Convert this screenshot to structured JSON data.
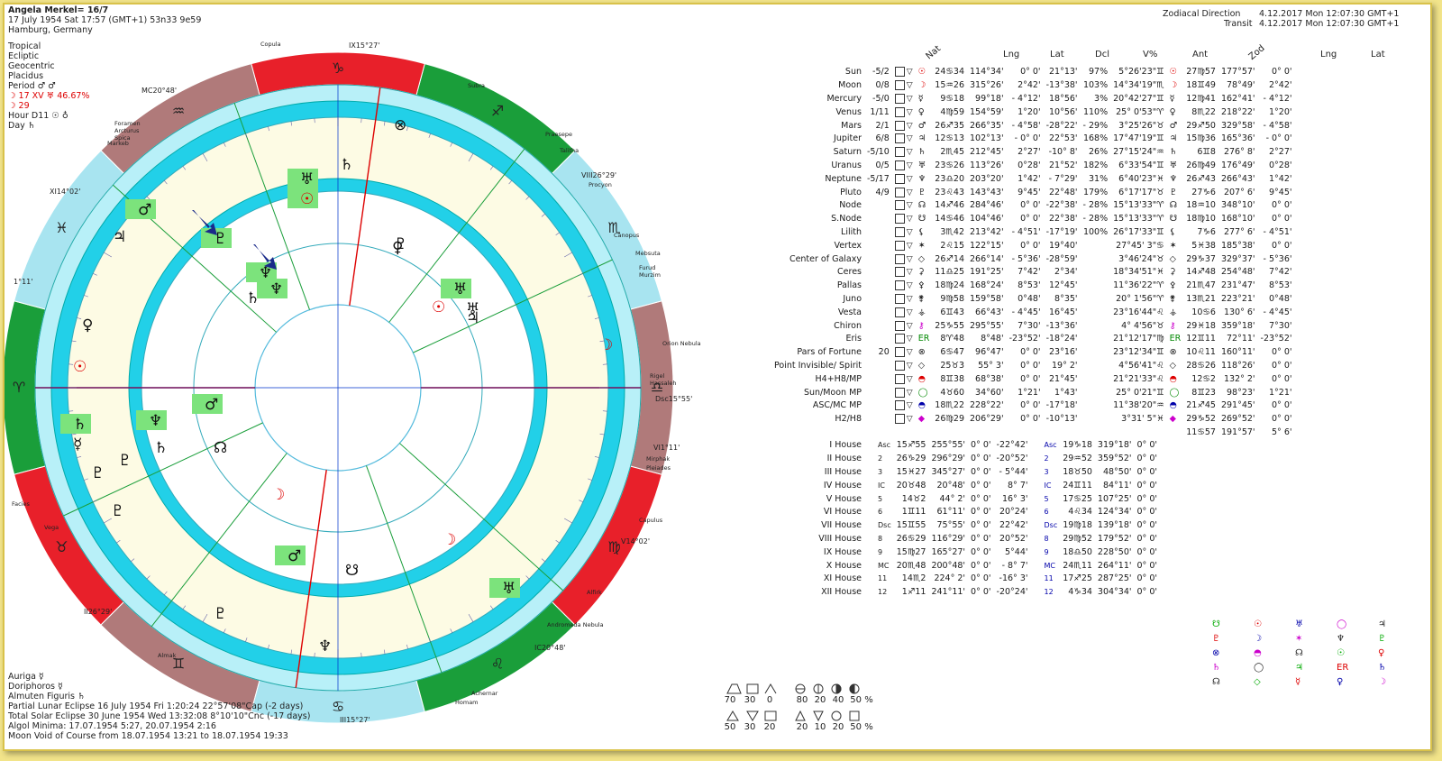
{
  "header": {
    "name": "Angela Merkel= 16/7",
    "date_line": "17 July 1954  Sat  17:57 (GMT+1) 53n33  9e59",
    "place": "Hamburg, Germany"
  },
  "settings": [
    "Tropical",
    "Ecliptic",
    "Geocentric",
    "Placidus",
    "Period ♂ ♂"
  ],
  "moon_line": "☽ 17 XV ♅ 46.67%",
  "moon_line2": "☽ 29",
  "hour_line": "Hour D11 ☉ ♁",
  "day_line": "Day ♄",
  "top_right": {
    "zd_label": "Zodiacal Direction",
    "zd_value": "4.12.2017  Mon 12:07:30 GMT+1",
    "tr_label": "Transit",
    "tr_value": "4.12.2017  Mon 12:07:30 GMT+1"
  },
  "columns": {
    "nat": "Nat",
    "lng": "Lng",
    "lat": "Lat",
    "dcl": "Dcl",
    "vpct": "V%",
    "ant": "Ant",
    "zod": "Zod",
    "lng2": "Lng",
    "lat2": "Lat"
  },
  "planets": [
    {
      "name": "Sun",
      "score": "-5/2",
      "sym": "☉",
      "c": "red",
      "lng": "24♋34",
      "lng2": "114°34'",
      "lat": "0° 0'",
      "dcl": "21°13'",
      "v": "97%",
      "ant": "5°26'23\"♊",
      "z": "27♍57",
      "zl": "177°57'",
      "zlat": "0° 0'"
    },
    {
      "name": "Moon",
      "score": "0/8",
      "sym": "☽",
      "c": "red",
      "lng": "15♒26",
      "lng2": "315°26'",
      "lat": "2°42'",
      "dcl": "-13°38'",
      "v": "103%",
      "ant": "14°34'19\"♏",
      "z": "18♊49",
      "zl": "78°49'",
      "zlat": "2°42'"
    },
    {
      "name": "Mercury",
      "score": "-5/0",
      "sym": "☿",
      "c": "",
      "lng": "9♋18",
      "lng2": "99°18'",
      "lat": "- 4°12'",
      "dcl": "18°56'",
      "v": "3%",
      "ant": "20°42'27\"♊",
      "z": "12♍41",
      "zl": "162°41'",
      "zlat": "- 4°12'"
    },
    {
      "name": "Venus",
      "score": "1/11",
      "sym": "♀",
      "c": "",
      "lng": "4♍59",
      "lng2": "154°59'",
      "lat": "1°20'",
      "dcl": "10°56'",
      "v": "110%",
      "ant": "25° 0'53\"♈",
      "z": "8♏22",
      "zl": "218°22'",
      "zlat": "1°20'"
    },
    {
      "name": "Mars",
      "score": "2/1",
      "sym": "♂",
      "c": "",
      "lng": "26♐35",
      "lng2": "266°35'",
      "lat": "- 4°58'",
      "dcl": "-28°22'",
      "v": "- 29%",
      "ant": "3°25'26\"♉",
      "z": "29♐50",
      "zl": "329°58'",
      "zlat": "- 4°58'"
    },
    {
      "name": "Jupiter",
      "score": "6/8",
      "sym": "♃",
      "c": "",
      "lng": "12♋13",
      "lng2": "102°13'",
      "lat": "- 0° 0'",
      "dcl": "22°53'",
      "v": "168%",
      "ant": "17°47'19\"♊",
      "z": "15♍36",
      "zl": "165°36'",
      "zlat": "- 0° 0'"
    },
    {
      "name": "Saturn",
      "score": "-5/10",
      "sym": "♄",
      "c": "",
      "lng": "2♏45",
      "lng2": "212°45'",
      "lat": "2°27'",
      "dcl": "-10° 8'",
      "v": "26%",
      "ant": "27°15'24\"♒",
      "z": "6♊8",
      "zl": "276° 8'",
      "zlat": "2°27'"
    },
    {
      "name": "Uranus",
      "score": "0/5",
      "sym": "♅",
      "c": "",
      "lng": "23♋26",
      "lng2": "113°26'",
      "lat": "0°28'",
      "dcl": "21°52'",
      "v": "182%",
      "ant": "6°33'54\"♊",
      "z": "26♍49",
      "zl": "176°49'",
      "zlat": "0°28'"
    },
    {
      "name": "Neptune",
      "score": "-5/17",
      "sym": "♆",
      "c": "",
      "lng": "23♎20",
      "lng2": "203°20'",
      "lat": "1°42'",
      "dcl": "- 7°29'",
      "v": "31%",
      "ant": "6°40'23\"♓",
      "z": "26♐43",
      "zl": "266°43'",
      "zlat": "1°42'"
    },
    {
      "name": "Pluto",
      "score": "4/9",
      "sym": "♇",
      "c": "",
      "lng": "23♌43",
      "lng2": "143°43'",
      "lat": "9°45'",
      "dcl": "22°48'",
      "v": "179%",
      "ant": "6°17'17\"♉",
      "z": "27♑6",
      "zl": "207° 6'",
      "zlat": "9°45'"
    },
    {
      "name": "Node",
      "score": "",
      "sym": "☊",
      "c": "",
      "lng": "14♐46",
      "lng2": "284°46'",
      "lat": "0° 0'",
      "dcl": "-22°38'",
      "v": "- 28%",
      "ant": "15°13'33\"♈",
      "z": "18♒10",
      "zl": "348°10'",
      "zlat": "0° 0'"
    },
    {
      "name": "S.Node",
      "score": "",
      "sym": "☋",
      "c": "",
      "lng": "14♋46",
      "lng2": "104°46'",
      "lat": "0° 0'",
      "dcl": "22°38'",
      "v": "- 28%",
      "ant": "15°13'33\"♈",
      "z": "18♍10",
      "zl": "168°10'",
      "zlat": "0° 0'"
    },
    {
      "name": "Lilith",
      "score": "",
      "sym": "⚸",
      "c": "",
      "lng": "3♏42",
      "lng2": "213°42'",
      "lat": "- 4°51'",
      "dcl": "-17°19'",
      "v": "100%",
      "ant": "26°17'33\"♊",
      "z": "7♑6",
      "zl": "277° 6'",
      "zlat": "- 4°51'"
    },
    {
      "name": "Vertex",
      "score": "",
      "sym": "✶",
      "c": "",
      "lng": "2♌15",
      "lng2": "122°15'",
      "lat": "0° 0'",
      "dcl": "19°40'",
      "v": "",
      "ant": "27°45' 3\"♋",
      "z": "5♓38",
      "zl": "185°38'",
      "zlat": "0° 0'"
    },
    {
      "name": "Center of Galaxy",
      "score": "",
      "sym": "◇",
      "c": "",
      "lng": "26♐14",
      "lng2": "266°14'",
      "lat": "- 5°36'",
      "dcl": "-28°59'",
      "v": "",
      "ant": "3°46'24\"♉",
      "z": "29♑37",
      "zl": "329°37'",
      "zlat": "- 5°36'"
    },
    {
      "name": "Ceres",
      "score": "",
      "sym": "⚳",
      "c": "",
      "lng": "11♎25",
      "lng2": "191°25'",
      "lat": "7°42'",
      "dcl": "2°34'",
      "v": "",
      "ant": "18°34'51\"♓",
      "z": "14♐48",
      "zl": "254°48'",
      "zlat": "7°42'"
    },
    {
      "name": "Pallas",
      "score": "",
      "sym": "⚴",
      "c": "",
      "lng": "18♍24",
      "lng2": "168°24'",
      "lat": "8°53'",
      "dcl": "12°45'",
      "v": "",
      "ant": "11°36'22\"♈",
      "z": "21♏47",
      "zl": "231°47'",
      "zlat": "8°53'"
    },
    {
      "name": "Juno",
      "score": "",
      "sym": "⚵",
      "c": "",
      "lng": "9♍58",
      "lng2": "159°58'",
      "lat": "0°48'",
      "dcl": "8°35'",
      "v": "",
      "ant": "20° 1'56\"♈",
      "z": "13♏21",
      "zl": "223°21'",
      "zlat": "0°48'"
    },
    {
      "name": "Vesta",
      "score": "",
      "sym": "⚶",
      "c": "",
      "lng": "6♊43",
      "lng2": "66°43'",
      "lat": "- 4°45'",
      "dcl": "16°45'",
      "v": "",
      "ant": "23°16'44\"♌",
      "z": "10♋6",
      "zl": "130° 6'",
      "zlat": "- 4°45'"
    },
    {
      "name": "Chiron",
      "score": "",
      "sym": "⚷",
      "c": "mag",
      "lng": "25♑55",
      "lng2": "295°55'",
      "lat": "7°30'",
      "dcl": "-13°36'",
      "v": "",
      "ant": "4° 4'56\"♉",
      "z": "29♓18",
      "zl": "359°18'",
      "zlat": "7°30'"
    },
    {
      "name": "Eris",
      "score": "",
      "sym": "ER",
      "c": "gr",
      "lng": "8♈48",
      "lng2": "8°48'",
      "lat": "-23°52'",
      "dcl": "-18°24'",
      "v": "",
      "ant": "21°12'17\"♍",
      "z": "12♊11",
      "zl": "72°11'",
      "zlat": "-23°52'"
    },
    {
      "name": "Pars of Fortune",
      "score": "20",
      "sym": "⊗",
      "c": "",
      "lng": "6♋47",
      "lng2": "96°47'",
      "lat": "0° 0'",
      "dcl": "23°16'",
      "v": "",
      "ant": "23°12'34\"♊",
      "z": "10♌11",
      "zl": "160°11'",
      "zlat": "0° 0'"
    },
    {
      "name": "Point Invisible/ Spirit",
      "score": "",
      "sym": "◇",
      "c": "",
      "lng": "25♉3",
      "lng2": "55° 3'",
      "lat": "0° 0'",
      "dcl": "19° 2'",
      "v": "",
      "ant": "4°56'41\"♌",
      "z": "28♋26",
      "zl": "118°26'",
      "zlat": "0° 0'"
    },
    {
      "name": "H4+H8/MP",
      "score": "",
      "sym": "◓",
      "c": "red",
      "lng": "8♊38",
      "lng2": "68°38'",
      "lat": "0° 0'",
      "dcl": "21°45'",
      "v": "",
      "ant": "21°21'33\"♌",
      "z": "12♋2",
      "zl": "132° 2'",
      "zlat": "0° 0'"
    },
    {
      "name": "Sun/Moon MP",
      "score": "",
      "sym": "◯",
      "c": "gr",
      "lng": "4♉60",
      "lng2": "34°60'",
      "lat": "1°21'",
      "dcl": "1°43'",
      "v": "",
      "ant": "25° 0'21\"♊",
      "z": "8♊23",
      "zl": "98°23'",
      "zlat": "1°21'"
    },
    {
      "name": "ASC/MC MP",
      "score": "",
      "sym": "◓",
      "c": "bl",
      "lng": "18♏22",
      "lng2": "228°22'",
      "lat": "0° 0'",
      "dcl": "-17°18'",
      "v": "",
      "ant": "11°38'20\"♒",
      "z": "21♐45",
      "zl": "291°45'",
      "zlat": "0° 0'"
    },
    {
      "name": "H2/H8",
      "score": "",
      "sym": "◆",
      "c": "mag",
      "lng": "26♍29",
      "lng2": "206°29'",
      "lat": "0° 0'",
      "dcl": "-10°13'",
      "v": "",
      "ant": "3°31' 5\"♓",
      "z": "29♑52",
      "zl": "269°52'",
      "zlat": "0° 0'"
    },
    {
      "name": "",
      "score": "",
      "sym": "",
      "c": "",
      "lng": "",
      "lng2": "",
      "lat": "",
      "dcl": "",
      "v": "",
      "ant": "",
      "z": "11♋57",
      "zl": "191°57'",
      "zlat": "5° 6'"
    }
  ],
  "houses": [
    {
      "name": "I House",
      "sym": "Asc",
      "lng": "15♐55",
      "lng2": "255°55'",
      "lat": "0° 0'",
      "dcl": "-22°42'",
      "z": "19♑18",
      "zl": "319°18'",
      "zlat": "0° 0'"
    },
    {
      "name": "II House",
      "sym": "2",
      "lng": "26♑29",
      "lng2": "296°29'",
      "lat": "0° 0'",
      "dcl": "-20°52'",
      "z": "29♒52",
      "zl": "359°52'",
      "zlat": "0° 0'"
    },
    {
      "name": "III House",
      "sym": "3",
      "lng": "15♓27",
      "lng2": "345°27'",
      "lat": "0° 0'",
      "dcl": "- 5°44'",
      "z": "18♉50",
      "zl": "48°50'",
      "zlat": "0° 0'"
    },
    {
      "name": "IV House",
      "sym": "IC",
      "lng": "20♉48",
      "lng2": "20°48'",
      "lat": "0° 0'",
      "dcl": "8° 7'",
      "z": "24♊11",
      "zl": "84°11'",
      "zlat": "0° 0'"
    },
    {
      "name": "V House",
      "sym": "5",
      "lng": "14♉2",
      "lng2": "44° 2'",
      "lat": "0° 0'",
      "dcl": "16° 3'",
      "z": "17♋25",
      "zl": "107°25'",
      "zlat": "0° 0'"
    },
    {
      "name": "VI House",
      "sym": "6",
      "lng": "1♊11",
      "lng2": "61°11'",
      "lat": "0° 0'",
      "dcl": "20°24'",
      "z": "4♌34",
      "zl": "124°34'",
      "zlat": "0° 0'"
    },
    {
      "name": "VII House",
      "sym": "Dsc",
      "lng": "15♊55",
      "lng2": "75°55'",
      "lat": "0° 0'",
      "dcl": "22°42'",
      "z": "19♍18",
      "zl": "139°18'",
      "zlat": "0° 0'"
    },
    {
      "name": "VIII House",
      "sym": "8",
      "lng": "26♋29",
      "lng2": "116°29'",
      "lat": "0° 0'",
      "dcl": "20°52'",
      "z": "29♍52",
      "zl": "179°52'",
      "zlat": "0° 0'"
    },
    {
      "name": "IX House",
      "sym": "9",
      "lng": "15♍27",
      "lng2": "165°27'",
      "lat": "0° 0'",
      "dcl": "5°44'",
      "z": "18♎50",
      "zl": "228°50'",
      "zlat": "0° 0'"
    },
    {
      "name": "X House",
      "sym": "MC",
      "lng": "20♏48",
      "lng2": "200°48'",
      "lat": "0° 0'",
      "dcl": "- 8° 7'",
      "z": "24♏11",
      "zl": "264°11'",
      "zlat": "0° 0'"
    },
    {
      "name": "XI House",
      "sym": "11",
      "lng": "14♏2",
      "lng2": "224° 2'",
      "lat": "0° 0'",
      "dcl": "-16° 3'",
      "z": "17♐25",
      "zl": "287°25'",
      "zlat": "0° 0'"
    },
    {
      "name": "XII House",
      "sym": "12",
      "lng": "1♐11",
      "lng2": "241°11'",
      "lat": "0° 0'",
      "dcl": "-20°24'",
      "z": "4♑34",
      "zl": "304°34'",
      "zlat": "0° 0'"
    }
  ],
  "bottom_left": [
    "Auriga  ☿",
    "Doriphoros  ☿",
    "Almuten Figuris  ♄",
    "Partial Lunar Eclipse 16 July 1954 Fri  1:20:24 22°57'08\"Cap (-2 days)",
    "Total Solar Eclipse 30 June 1954 Wed 13:32:08  8°10'10\"Cnc (-17 days)",
    "Algol Minima: 17.07.1954  5:27, 20.07.1954  2:16",
    "Moon Void of Course from 18.07.1954 13:21 to 18.07.1954 19:33"
  ],
  "element_stats": {
    "row1_labels": [
      "70",
      "30",
      "0"
    ],
    "row1_pcts": [
      "80",
      "20",
      "40",
      "50 %"
    ],
    "row2_labels": [
      "50",
      "30",
      "20"
    ],
    "row2_pcts": [
      "20",
      "10",
      "20",
      "50 %"
    ]
  },
  "chart": {
    "signs": [
      "♈",
      "♉",
      "♊",
      "♋",
      "♌",
      "♍",
      "♎",
      "♏",
      "♐",
      "♑",
      "♒",
      "♓"
    ],
    "cusps": {
      "asc": "1°11'",
      "mc": "MC20°48'",
      "ix": "IX15°27'",
      "iii": "III15°27'",
      "dsc": "Dsc15°55'",
      "xi": "XI14°02'",
      "viii": "VIII26°29'",
      "ii": "II26°29'",
      "v": "V14°02'",
      "vi": "VI1°11'",
      "ic": "IC20°48'"
    },
    "stars": [
      "Praesepe",
      "Talitha",
      "Procyon",
      "Canopus",
      "Mebsuta",
      "Furud",
      "Murzim",
      "Orion Nebula",
      "Rigel",
      "Hassaleh",
      "Mirphak",
      "Pleiades",
      "Capulus",
      "Alfirk",
      "Andromeda Nebula",
      "Achernar",
      "Homam",
      "Almak",
      "Vega",
      "Facies",
      "Foramen",
      "Arcturus",
      "Spica",
      "Markeb",
      "Copula",
      "Subra"
    ]
  }
}
